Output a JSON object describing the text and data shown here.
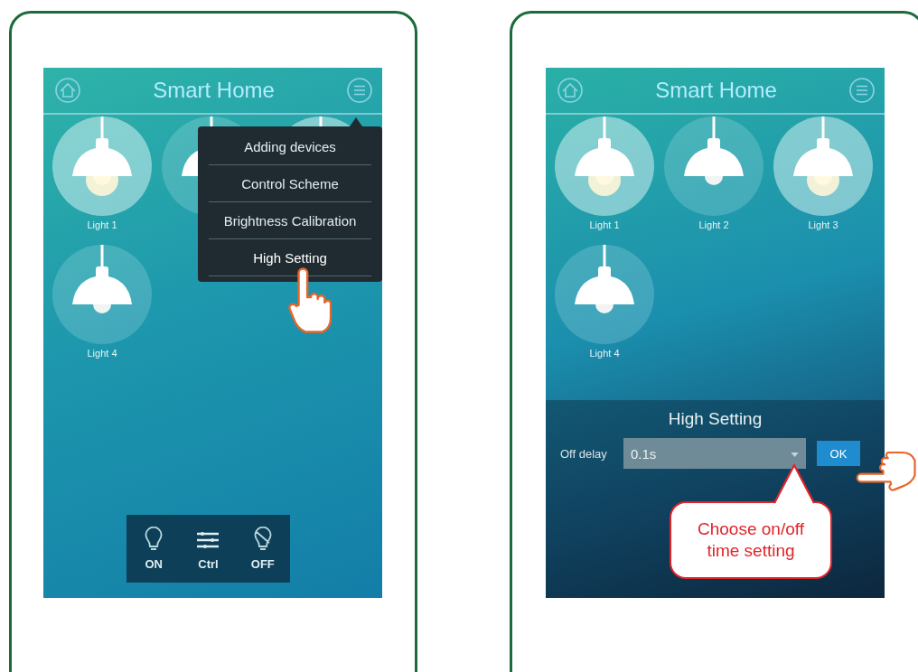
{
  "screens": [
    {
      "header": {
        "title": "Smart Home"
      },
      "lights": [
        {
          "label": "Light 1",
          "on": true
        },
        {
          "on": false
        },
        {
          "on": true
        },
        {
          "label": "Light 4",
          "on": false
        }
      ],
      "menu": {
        "items": [
          {
            "label": "Adding devices",
            "selected": false
          },
          {
            "label": "Control Scheme",
            "selected": false
          },
          {
            "label": "Brightness Calibration",
            "selected": false
          },
          {
            "label": "High Setting",
            "selected": true
          }
        ]
      },
      "toolbar": [
        {
          "kind": "on",
          "label": "ON"
        },
        {
          "kind": "ctrl",
          "label": "Ctrl"
        },
        {
          "kind": "off",
          "label": "OFF"
        }
      ]
    },
    {
      "header": {
        "title": "Smart Home"
      },
      "lights": [
        {
          "label": "Light 1",
          "on": true
        },
        {
          "label": "Light 2",
          "on": false
        },
        {
          "label": "Light 3",
          "on": true
        },
        {
          "label": "Light 4",
          "on": false
        }
      ],
      "dialog": {
        "title": "High Setting",
        "field_label": "Off delay",
        "value": "0.1s",
        "button": "OK",
        "callout": "Choose on/off time setting"
      }
    }
  ]
}
